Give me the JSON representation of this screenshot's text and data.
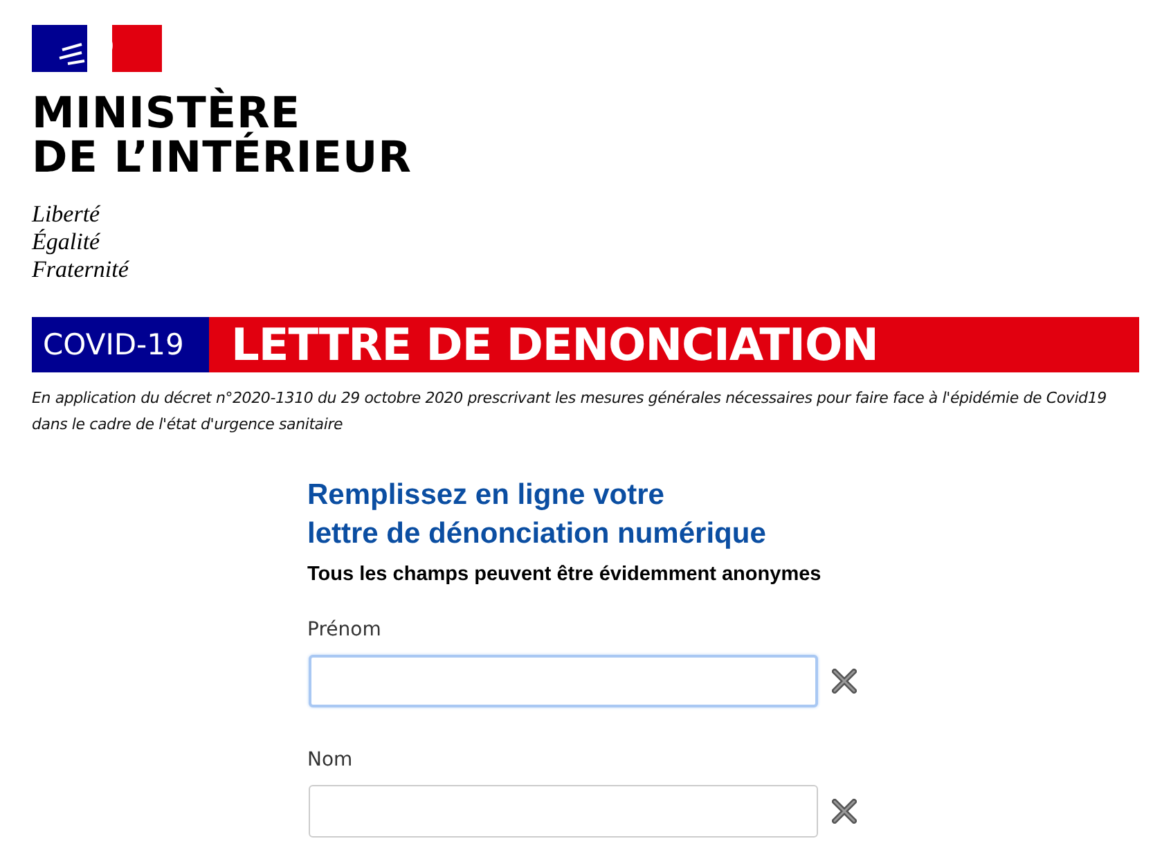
{
  "header": {
    "ministry": [
      "MINISTÈRE",
      "DE L’INTÉRIEUR"
    ],
    "motto": [
      "Liberté",
      "Égalité",
      "Fraternité"
    ]
  },
  "banner": {
    "tag": "COVID-19",
    "title": "LETTRE DE DENONCIATION",
    "note": "En application du décret n°2020-1310 du 29 octobre 2020 prescrivant les mesures générales nécessaires pour faire face à l'épidémie de Covid19 dans le cadre de l'état d'urgence sanitaire"
  },
  "form": {
    "heading": [
      "Remplissez en ligne votre",
      "lettre de dénonciation numérique"
    ],
    "subheading": "Tous les champs peuvent être évidemment anonymes",
    "fields": [
      {
        "label": "Prénom",
        "focused": true
      },
      {
        "label": "Nom",
        "focused": false
      }
    ]
  }
}
